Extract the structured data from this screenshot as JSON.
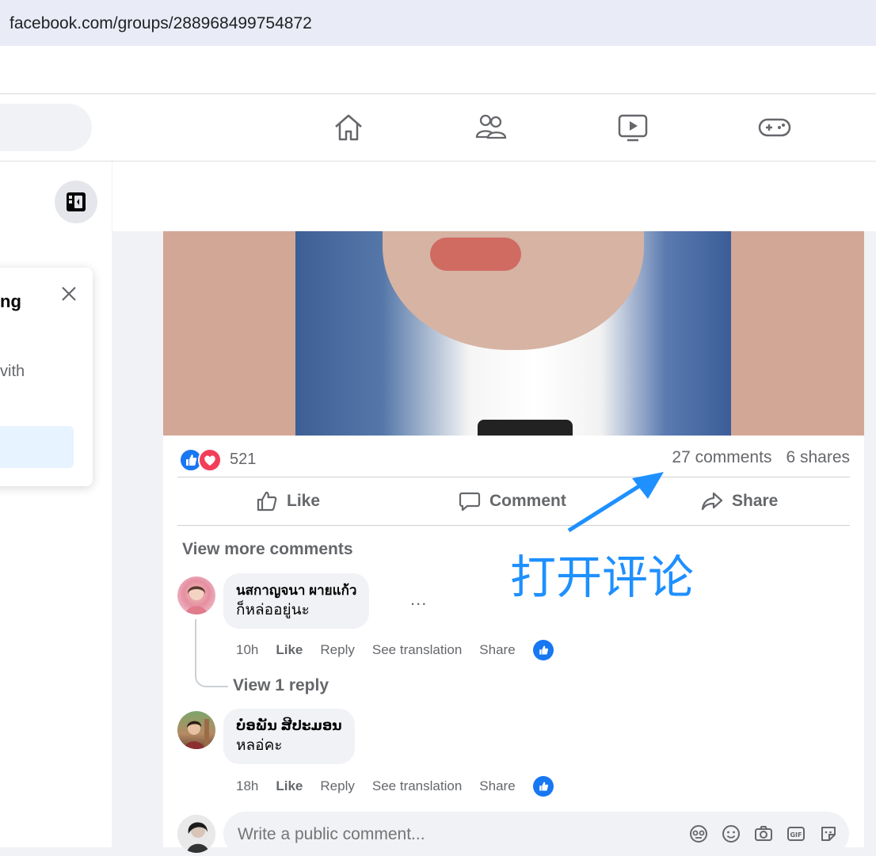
{
  "browser": {
    "url": "facebook.com/groups/288968499754872"
  },
  "nav": {
    "icons": [
      "home-icon",
      "friends-icon",
      "watch-icon",
      "gaming-icon"
    ]
  },
  "left_card": {
    "title_fragment": "ng",
    "text_fragment": "vith"
  },
  "post": {
    "reaction_count": "521",
    "comments_count": "27 comments",
    "shares_count": "6 shares",
    "actions": {
      "like": "Like",
      "comment": "Comment",
      "share": "Share"
    },
    "view_more": "View more comments",
    "comments": [
      {
        "author": "นสกาญจนา ผายแก้ว",
        "text": "ก็หล่ออยู่นะ",
        "time": "10h",
        "like": "Like",
        "reply": "Reply",
        "translate": "See translation",
        "share": "Share"
      },
      {
        "author": "ບໍ່ອພັນ ສີປະມອນ",
        "text": "หลอ่คะ",
        "time": "18h",
        "like": "Like",
        "reply": "Reply",
        "translate": "See translation",
        "share": "Share"
      }
    ],
    "view_reply": "View 1 reply",
    "more_dots": "...",
    "write_placeholder": "Write a public comment..."
  },
  "annotation": "打开评论",
  "colors": {
    "brand_blue": "#1877f2",
    "annotation_blue": "#1e90ff",
    "love_red": "#f33e58"
  }
}
